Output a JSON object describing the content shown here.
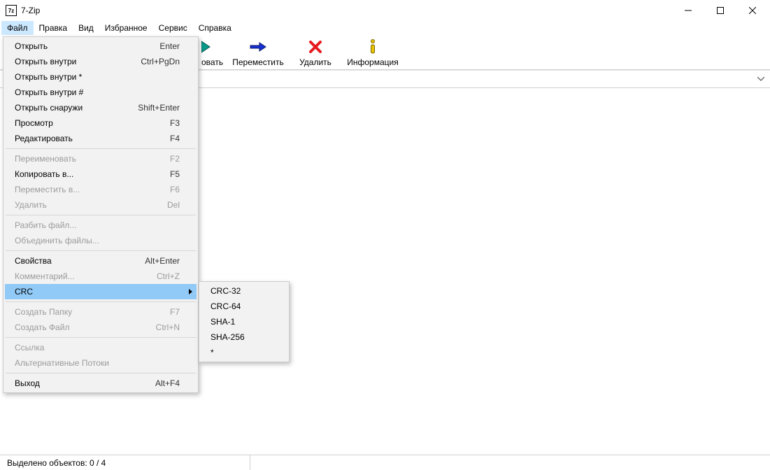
{
  "titlebar": {
    "icon_text": "7z",
    "title": "7-Zip"
  },
  "menubar": {
    "items": [
      "Файл",
      "Правка",
      "Вид",
      "Избранное",
      "Сервис",
      "Справка"
    ]
  },
  "toolbar": {
    "items": [
      {
        "name": "extract",
        "label": "овать"
      },
      {
        "name": "move",
        "label": "Переместить"
      },
      {
        "name": "delete",
        "label": "Удалить"
      },
      {
        "name": "info",
        "label": "Информация"
      }
    ]
  },
  "address": {
    "value": ""
  },
  "file_menu": {
    "groups": [
      [
        {
          "label": "Открыть",
          "shortcut": "Enter",
          "disabled": false
        },
        {
          "label": "Открыть внутри",
          "shortcut": "Ctrl+PgDn",
          "disabled": false
        },
        {
          "label": "Открыть внутри *",
          "shortcut": "",
          "disabled": false
        },
        {
          "label": "Открыть внутри #",
          "shortcut": "",
          "disabled": false
        },
        {
          "label": "Открыть снаружи",
          "shortcut": "Shift+Enter",
          "disabled": false
        },
        {
          "label": "Просмотр",
          "shortcut": "F3",
          "disabled": false
        },
        {
          "label": "Редактировать",
          "shortcut": "F4",
          "disabled": false
        }
      ],
      [
        {
          "label": "Переименовать",
          "shortcut": "F2",
          "disabled": true
        },
        {
          "label": "Копировать в...",
          "shortcut": "F5",
          "disabled": false
        },
        {
          "label": "Переместить в...",
          "shortcut": "F6",
          "disabled": true
        },
        {
          "label": "Удалить",
          "shortcut": "Del",
          "disabled": true
        }
      ],
      [
        {
          "label": "Разбить файл...",
          "shortcut": "",
          "disabled": true
        },
        {
          "label": "Объединить файлы...",
          "shortcut": "",
          "disabled": true
        }
      ],
      [
        {
          "label": "Свойства",
          "shortcut": "Alt+Enter",
          "disabled": false
        },
        {
          "label": "Комментарий...",
          "shortcut": "Ctrl+Z",
          "disabled": true
        },
        {
          "label": "CRC",
          "shortcut": "",
          "disabled": false,
          "submenu": true,
          "highlight": true
        }
      ],
      [
        {
          "label": "Создать Папку",
          "shortcut": "F7",
          "disabled": true
        },
        {
          "label": "Создать Файл",
          "shortcut": "Ctrl+N",
          "disabled": true
        }
      ],
      [
        {
          "label": "Ссылка",
          "shortcut": "",
          "disabled": true
        },
        {
          "label": "Альтернативные Потоки",
          "shortcut": "",
          "disabled": true
        }
      ],
      [
        {
          "label": "Выход",
          "shortcut": "Alt+F4",
          "disabled": false
        }
      ]
    ]
  },
  "crc_submenu": {
    "items": [
      "CRC-32",
      "CRC-64",
      "SHA-1",
      "SHA-256",
      "*"
    ]
  },
  "statusbar": {
    "text": "Выделено объектов: 0 / 4"
  }
}
